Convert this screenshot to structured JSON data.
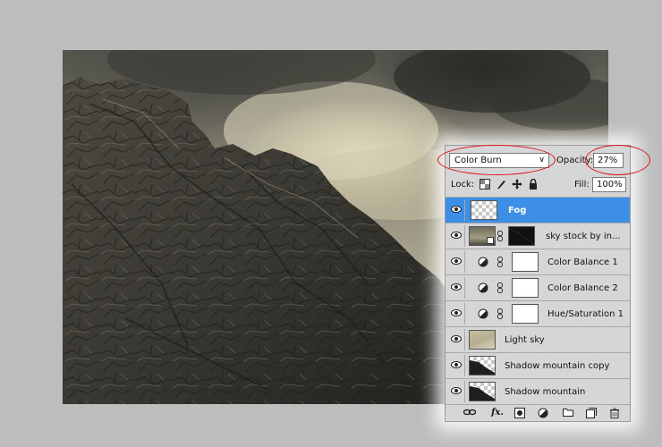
{
  "canvas": {
    "description_icon": "mountain-artwork"
  },
  "layers_panel": {
    "blend_mode": "Color Burn",
    "opacity_label": "Opacity:",
    "opacity_value": "27%",
    "lock_label": "Lock:",
    "fill_label": "Fill:",
    "fill_value": "100%",
    "layers": [
      {
        "name": "Fog",
        "selected": true,
        "visible": true,
        "type": "pixel"
      },
      {
        "name": "sky stock by in...",
        "selected": false,
        "visible": true,
        "type": "smart-object-with-mask"
      },
      {
        "name": "Color Balance 1",
        "selected": false,
        "visible": true,
        "type": "adjustment"
      },
      {
        "name": "Color Balance 2",
        "selected": false,
        "visible": true,
        "type": "adjustment"
      },
      {
        "name": "Hue/Saturation 1",
        "selected": false,
        "visible": true,
        "type": "adjustment"
      },
      {
        "name": "Light sky",
        "selected": false,
        "visible": true,
        "type": "pixel"
      },
      {
        "name": "Shadow mountain copy",
        "selected": false,
        "visible": true,
        "type": "pixel"
      },
      {
        "name": "Shadow mountain",
        "selected": false,
        "visible": true,
        "type": "pixel"
      }
    ],
    "footer_fx": "fx."
  },
  "colors": {
    "selection": "#3d8ee6",
    "annotation": "#d8141b",
    "panel_bg": "#d6d6d6"
  }
}
